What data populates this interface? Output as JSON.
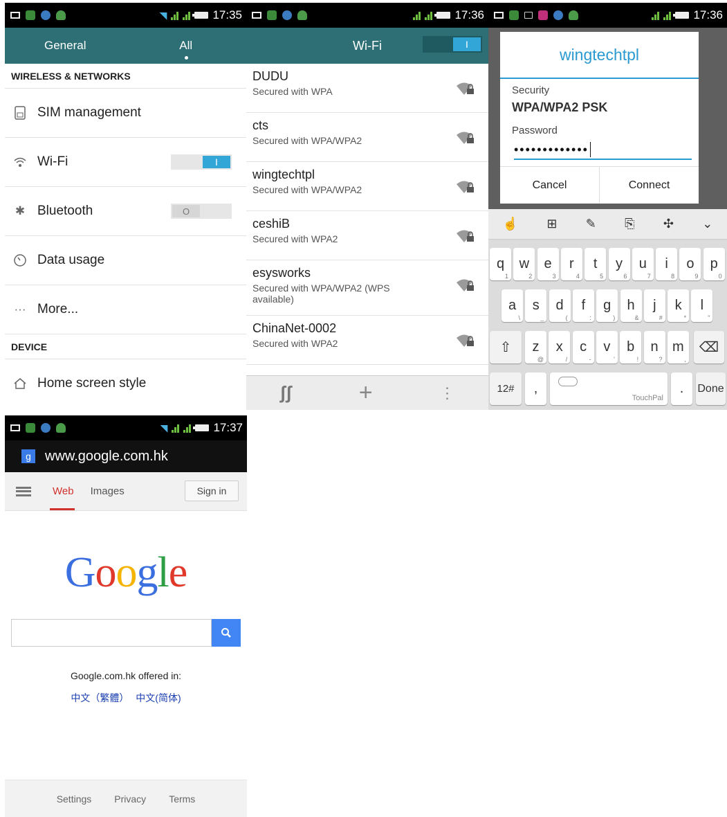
{
  "settings": {
    "time": "17:35",
    "tab_general": "General",
    "tab_all": "All",
    "section_wireless": "WIRELESS & NETWORKS",
    "sim": "SIM management",
    "wifi": "Wi-Fi",
    "bluetooth": "Bluetooth",
    "data_usage": "Data usage",
    "more": "More...",
    "section_device": "DEVICE",
    "home_screen": "Home screen style"
  },
  "wifi_list": {
    "time": "17:36",
    "title": "Wi-Fi",
    "networks": [
      {
        "name": "DUDU",
        "security": "Secured with WPA"
      },
      {
        "name": "cts",
        "security": "Secured with WPA/WPA2"
      },
      {
        "name": "wingtechtpl",
        "security": "Secured with WPA/WPA2"
      },
      {
        "name": "ceshiB",
        "security": "Secured with WPA2"
      },
      {
        "name": "esysworks",
        "security": "Secured with WPA/WPA2 (WPS available)"
      },
      {
        "name": "ChinaNet-0002",
        "security": "Secured with WPA2"
      }
    ]
  },
  "dialog": {
    "time": "17:36",
    "title": "wingtechtpl",
    "security_label": "Security",
    "security_value": "WPA/WPA2 PSK",
    "password_label": "Password",
    "password_value": "•••••••••••••",
    "cancel": "Cancel",
    "connect": "Connect"
  },
  "keyboard": {
    "row1": [
      [
        "q",
        "1"
      ],
      [
        "w",
        "2"
      ],
      [
        "e",
        "3"
      ],
      [
        "r",
        "4"
      ],
      [
        "t",
        "5"
      ],
      [
        "y",
        "6"
      ],
      [
        "u",
        "7"
      ],
      [
        "i",
        "8"
      ],
      [
        "o",
        "9"
      ],
      [
        "p",
        "0"
      ]
    ],
    "row2": [
      [
        "a",
        "\\"
      ],
      [
        "s",
        "_"
      ],
      [
        "d",
        "("
      ],
      [
        "f",
        ":"
      ],
      [
        "g",
        ")"
      ],
      [
        "h",
        "&"
      ],
      [
        "j",
        "#"
      ],
      [
        "k",
        "*"
      ],
      [
        "l",
        "\""
      ]
    ],
    "row3": [
      [
        "z",
        "@"
      ],
      [
        "x",
        "/"
      ],
      [
        "c",
        "-"
      ],
      [
        "v",
        "'"
      ],
      [
        "b",
        "!"
      ],
      [
        "n",
        "?"
      ],
      [
        "m",
        ","
      ]
    ],
    "num": "12#",
    "comma": ",",
    "brand": "TouchPal",
    "period": ".",
    "done": "Done"
  },
  "browser": {
    "time": "17:37",
    "url": "www.google.com.hk",
    "nav_web": "Web",
    "nav_images": "Images",
    "sign_in": "Sign in",
    "logo": "Google",
    "offered": "Google.com.hk offered in:",
    "lang1": "中文（繁體）",
    "lang2": "中文(简体)",
    "footer": [
      "Settings",
      "Privacy",
      "Terms"
    ]
  },
  "colors": {
    "teal": "#2d6f75",
    "switch_on": "#33a6d8",
    "google_blue": "#4285f4"
  }
}
